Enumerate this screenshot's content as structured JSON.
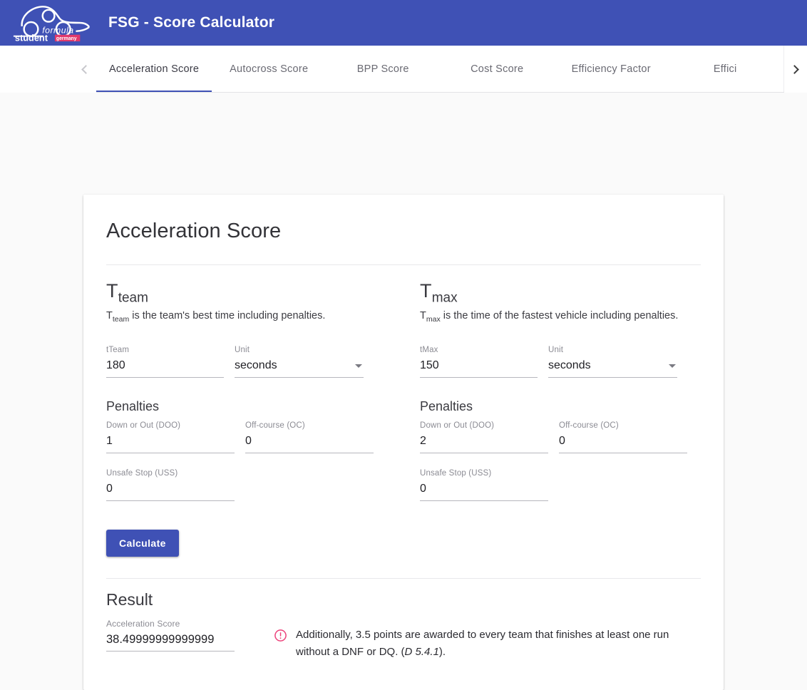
{
  "app": {
    "title": "FSG - Score Calculator",
    "logo_alt": "formula student germany",
    "logo_text_top": "formula",
    "logo_text_bottom": "student",
    "logo_text_badge": "germany",
    "brand_color": "#3f51b5",
    "accent_color": "#e91e63"
  },
  "tabs": {
    "scroll_prev_icon": "chevron-left-icon",
    "scroll_next_icon": "chevron-right-icon",
    "active_index": 0,
    "items": [
      {
        "label": "Acceleration Score"
      },
      {
        "label": "Autocross Score"
      },
      {
        "label": "BPP Score"
      },
      {
        "label": "Cost Score"
      },
      {
        "label": "Efficiency Factor"
      },
      {
        "label": "Effici"
      }
    ]
  },
  "card": {
    "title": "Acceleration Score",
    "left": {
      "heading_base": "T",
      "heading_sub": "team",
      "desc_prefix": "T",
      "desc_sub": "team",
      "desc_rest": " is the team's best time including penalties.",
      "time_field": {
        "label": "tTeam",
        "value": "180"
      },
      "unit_field": {
        "label": "Unit",
        "value": "seconds",
        "caret_icon": "chevron-down-icon"
      },
      "penalties_title": "Penalties",
      "penalties": [
        {
          "label": "Down or Out (DOO)",
          "value": "1"
        },
        {
          "label": "Off-course (OC)",
          "value": "0"
        },
        {
          "label": "Unsafe Stop (USS)",
          "value": "0"
        }
      ]
    },
    "right": {
      "heading_base": "T",
      "heading_sub": "max",
      "desc_prefix": "T",
      "desc_sub": "max",
      "desc_rest": " is the time of the fastest vehicle including penalties.",
      "time_field": {
        "label": "tMax",
        "value": "150"
      },
      "unit_field": {
        "label": "Unit",
        "value": "seconds",
        "caret_icon": "chevron-down-icon"
      },
      "penalties_title": "Penalties",
      "penalties": [
        {
          "label": "Down or Out (DOO)",
          "value": "2"
        },
        {
          "label": "Off-course (OC)",
          "value": "0"
        },
        {
          "label": "Unsafe Stop (USS)",
          "value": "0"
        }
      ]
    },
    "calculate_label": "Calculate",
    "result": {
      "title": "Result",
      "score_label": "Acceleration Score",
      "score_value": "38.49999999999999",
      "note_icon": "error-outline-icon",
      "note_text_main": "Additionally, 3.5 points are awarded to every team that finishes at least one run without a DNF or DQ. (",
      "note_text_ref": "D 5.4.1",
      "note_text_suffix": ")."
    }
  }
}
